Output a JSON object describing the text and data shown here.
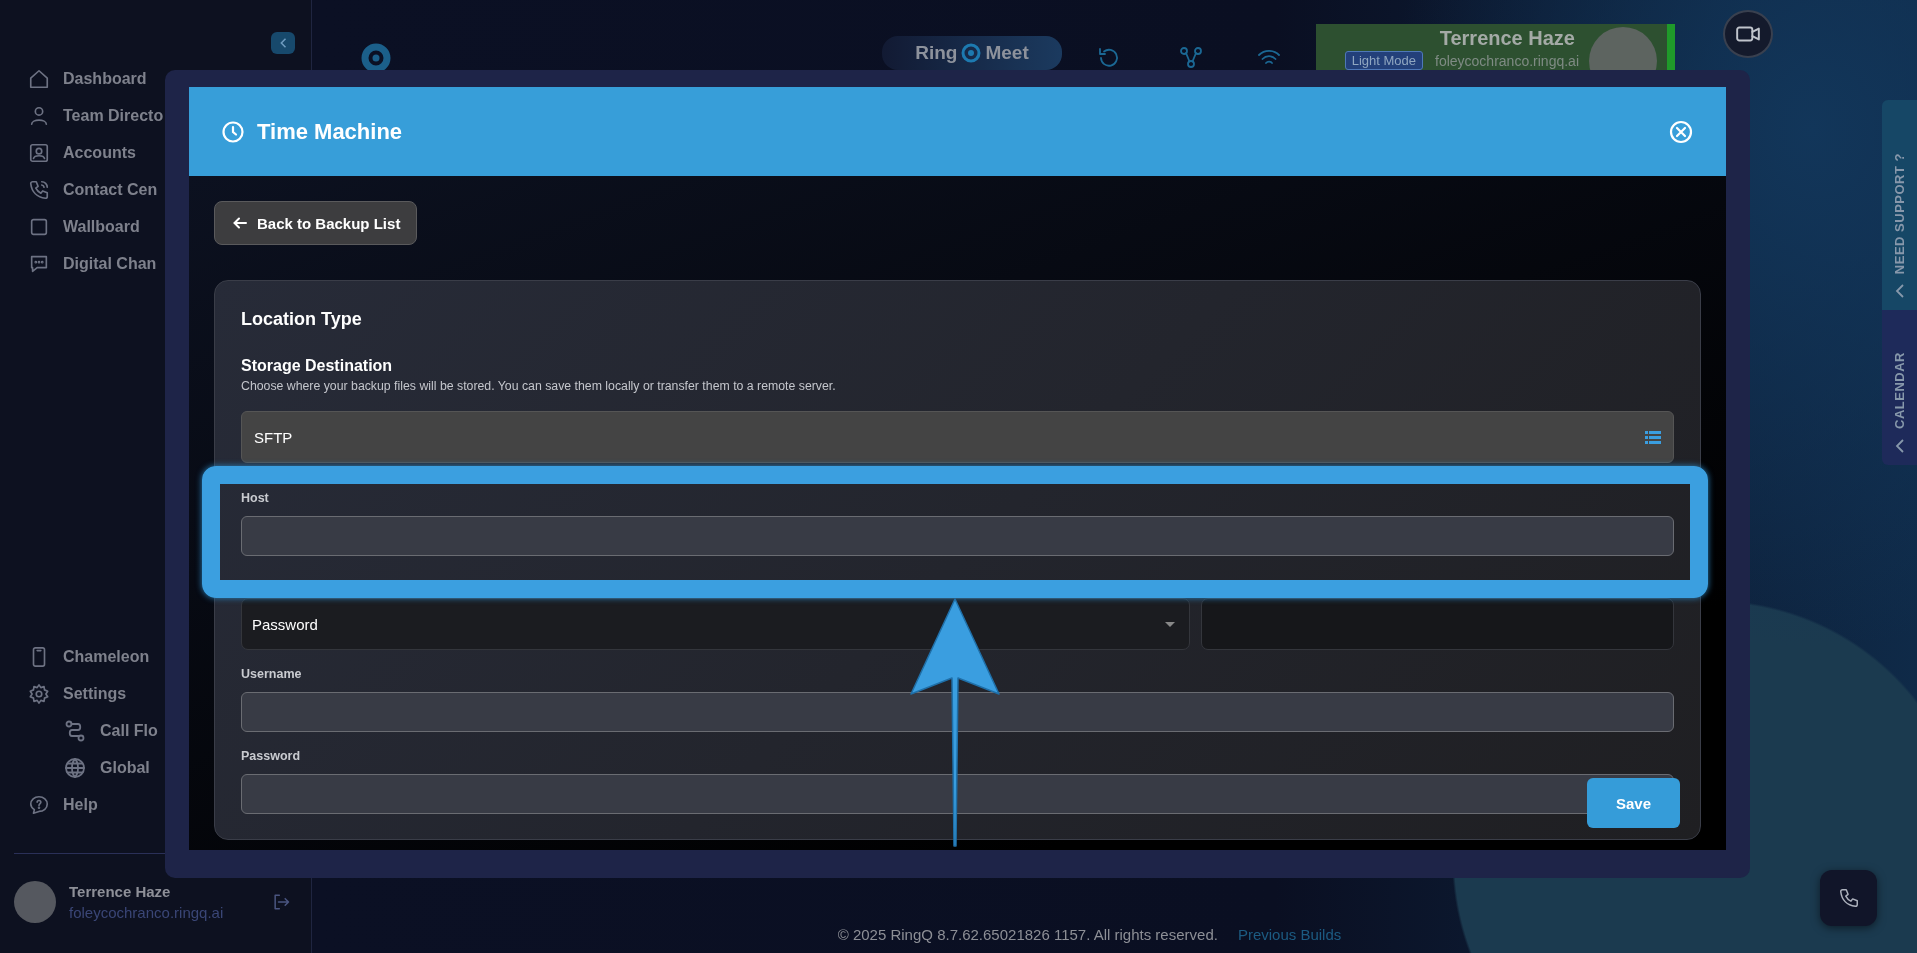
{
  "sidebar": {
    "items": [
      {
        "label": "Dashboard"
      },
      {
        "label": "Team Directo"
      },
      {
        "label": "Accounts"
      },
      {
        "label": "Contact Cen"
      },
      {
        "label": "Wallboard"
      },
      {
        "label": "Digital Chan"
      }
    ],
    "bottom_items": [
      {
        "label": "Chameleon"
      },
      {
        "label": "Settings",
        "children": [
          {
            "label": "Call Flo"
          },
          {
            "label": "Global"
          }
        ]
      },
      {
        "label": "Help"
      }
    ],
    "user": {
      "name": "Terrence Haze",
      "email": "foleycochranco.ringq.ai"
    }
  },
  "header": {
    "meet_button": {
      "prefix": "Ring",
      "suffix": "Meet"
    },
    "profile": {
      "name": "Terrence Haze",
      "mode_button": "Light Mode",
      "email": "foleycochranco.ringq.ai"
    }
  },
  "side_tabs": [
    {
      "label": "NEED SUPPORT ?"
    },
    {
      "label": "CALENDAR"
    }
  ],
  "modal": {
    "title": "Time Machine",
    "back_button": "Back to Backup List",
    "section_title": "Location Type",
    "storage": {
      "label": "Storage Destination",
      "description": "Choose where your backup files will be stored. You can save them locally or transfer them to a remote server.",
      "value": "SFTP"
    },
    "fields": [
      {
        "kind": "text",
        "label": "Host"
      },
      {
        "kind": "select-pair",
        "value": "Password"
      },
      {
        "kind": "text",
        "label": "Username"
      },
      {
        "kind": "text",
        "label": "Password"
      }
    ],
    "save_button": "Save"
  },
  "footer": {
    "copyright": "© 2025 RingQ 8.7.62.65021826 1157. All rights reserved.",
    "link": "Previous Builds"
  }
}
